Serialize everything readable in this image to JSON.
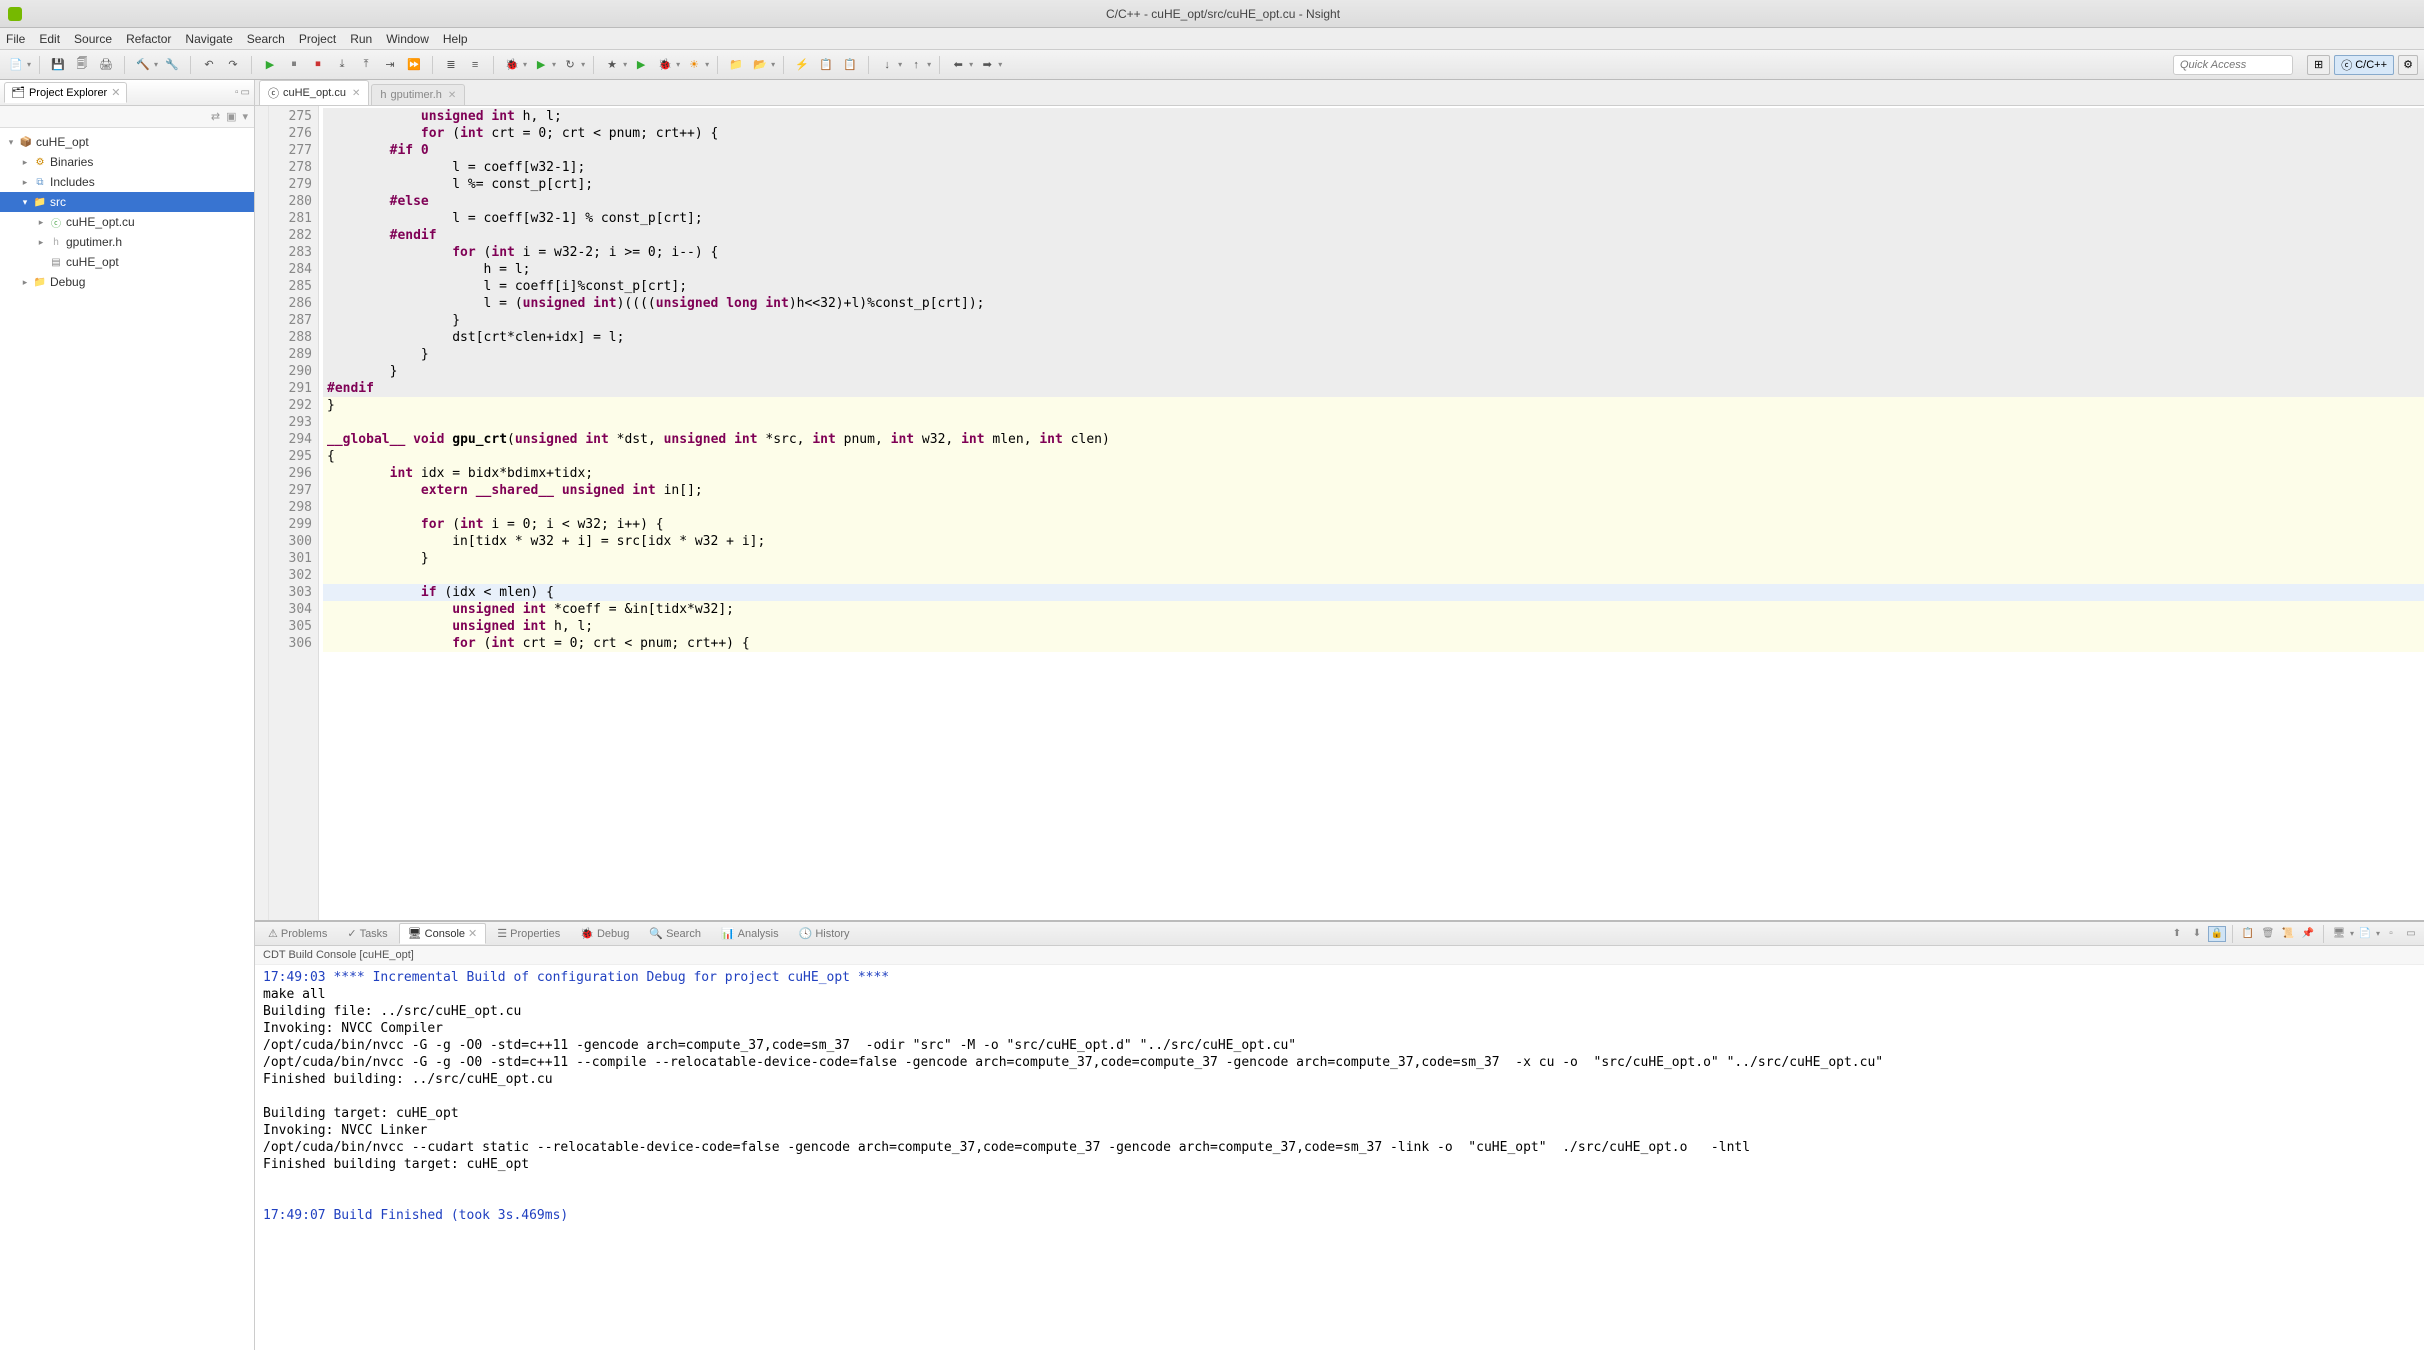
{
  "window": {
    "title": "C/C++ - cuHE_opt/src/cuHE_opt.cu - Nsight"
  },
  "menubar": [
    "File",
    "Edit",
    "Source",
    "Refactor",
    "Navigate",
    "Search",
    "Project",
    "Run",
    "Window",
    "Help"
  ],
  "quick_access_placeholder": "Quick Access",
  "perspective": {
    "active": "C/C++"
  },
  "sidebar": {
    "view_title": "Project Explorer",
    "tree": {
      "project": "cuHE_opt",
      "binaries": "Binaries",
      "includes": "Includes",
      "src": "src",
      "src_children": [
        {
          "name": "cuHE_opt.cu"
        },
        {
          "name": "gputimer.h"
        },
        {
          "name": "cuHE_opt"
        }
      ],
      "debug": "Debug"
    }
  },
  "editor": {
    "tabs": [
      {
        "label": "cuHE_opt.cu",
        "active": true
      },
      {
        "label": "gputimer.h",
        "active": false
      }
    ],
    "first_line": 275,
    "lines": [
      {
        "n": 275,
        "bg": "gray",
        "html": "            <span class='kw'>unsigned</span> <span class='kw'>int</span> h, l;"
      },
      {
        "n": 276,
        "bg": "gray",
        "html": "            <span class='kw'>for</span> (<span class='kw'>int</span> crt = 0; crt &lt; pnum; crt++) {"
      },
      {
        "n": 277,
        "bg": "gray",
        "html": "        <span class='pp'>#if 0</span>"
      },
      {
        "n": 278,
        "bg": "gray",
        "html": "                l = coeff[w32-1];"
      },
      {
        "n": 279,
        "bg": "gray",
        "html": "                l %= const_p[crt];"
      },
      {
        "n": 280,
        "bg": "gray",
        "html": "        <span class='pp'>#else</span>"
      },
      {
        "n": 281,
        "bg": "gray",
        "html": "                l = coeff[w32-1] % const_p[crt];"
      },
      {
        "n": 282,
        "bg": "gray",
        "html": "        <span class='pp'>#endif</span>"
      },
      {
        "n": 283,
        "bg": "gray",
        "html": "                <span class='kw'>for</span> (<span class='kw'>int</span> i = w32-2; i &gt;= 0; i--) {"
      },
      {
        "n": 284,
        "bg": "gray",
        "html": "                    h = l;"
      },
      {
        "n": 285,
        "bg": "gray",
        "html": "                    l = coeff[i]%const_p[crt];"
      },
      {
        "n": 286,
        "bg": "gray",
        "html": "                    l = (<span class='kw'>unsigned</span> <span class='kw'>int</span>)((((<span class='kw'>unsigned</span> <span class='kw'>long</span> <span class='kw'>int</span>)h&lt;&lt;32)+l)%const_p[crt]);"
      },
      {
        "n": 287,
        "bg": "gray",
        "html": "                }"
      },
      {
        "n": 288,
        "bg": "gray",
        "html": "                dst[crt*clen+idx] = l;"
      },
      {
        "n": 289,
        "bg": "gray",
        "html": "            }"
      },
      {
        "n": 290,
        "bg": "gray",
        "html": "        }"
      },
      {
        "n": 291,
        "bg": "gray",
        "html": "<span class='pp'>#endif</span>"
      },
      {
        "n": 292,
        "bg": "yel",
        "html": "}"
      },
      {
        "n": 293,
        "bg": "yel",
        "html": " "
      },
      {
        "n": 294,
        "bg": "yel",
        "html": "<span class='kw'>__global__</span> <span class='kw'>void</span> <span class='fn'>gpu_crt</span>(<span class='kw'>unsigned</span> <span class='kw'>int</span> *dst, <span class='kw'>unsigned</span> <span class='kw'>int</span> *src, <span class='kw'>int</span> pnum, <span class='kw'>int</span> w32, <span class='kw'>int</span> mlen, <span class='kw'>int</span> clen)"
      },
      {
        "n": 295,
        "bg": "yel",
        "html": "{"
      },
      {
        "n": 296,
        "bg": "yel",
        "html": "        <span class='kw'>int</span> idx = bidx*bdimx+tidx;"
      },
      {
        "n": 297,
        "bg": "yel",
        "html": "            <span class='kw'>extern</span> <span class='kw'>__shared__</span> <span class='kw'>unsigned</span> <span class='kw'>int</span> in[];"
      },
      {
        "n": 298,
        "bg": "yel",
        "html": " "
      },
      {
        "n": 299,
        "bg": "yel",
        "html": "            <span class='kw'>for</span> (<span class='kw'>int</span> i = 0; i &lt; w32; i++) {"
      },
      {
        "n": 300,
        "bg": "yel",
        "html": "                in[tidx * w32 + i] = src[idx * w32 + i];"
      },
      {
        "n": 301,
        "bg": "yel",
        "html": "            }"
      },
      {
        "n": 302,
        "bg": "yel",
        "html": " "
      },
      {
        "n": 303,
        "bg": "cur",
        "html": "            <span class='kw'>if</span> (idx &lt; mlen) {"
      },
      {
        "n": 304,
        "bg": "yel",
        "html": "                <span class='kw'>unsigned</span> <span class='kw'>int</span> *coeff = &amp;in[tidx*w32];"
      },
      {
        "n": 305,
        "bg": "yel",
        "html": "                <span class='kw'>unsigned</span> <span class='kw'>int</span> h, l;"
      },
      {
        "n": 306,
        "bg": "yel",
        "html": "                <span class='kw'>for</span> (<span class='kw'>int</span> crt = 0; crt &lt; pnum; crt++) {"
      }
    ]
  },
  "bottom": {
    "tabs": [
      "Problems",
      "Tasks",
      "Console",
      "Properties",
      "Debug",
      "Search",
      "Analysis",
      "History"
    ],
    "active_tab_index": 2,
    "console_header": "CDT Build Console [cuHE_opt]",
    "console_lines": [
      {
        "cls": "blue",
        "text": "17:49:03 **** Incremental Build of configuration Debug for project cuHE_opt ****"
      },
      {
        "cls": "",
        "text": "make all "
      },
      {
        "cls": "",
        "text": "Building file: ../src/cuHE_opt.cu"
      },
      {
        "cls": "",
        "text": "Invoking: NVCC Compiler"
      },
      {
        "cls": "",
        "text": "/opt/cuda/bin/nvcc -G -g -O0 -std=c++11 -gencode arch=compute_37,code=sm_37  -odir \"src\" -M -o \"src/cuHE_opt.d\" \"../src/cuHE_opt.cu\""
      },
      {
        "cls": "",
        "text": "/opt/cuda/bin/nvcc -G -g -O0 -std=c++11 --compile --relocatable-device-code=false -gencode arch=compute_37,code=compute_37 -gencode arch=compute_37,code=sm_37  -x cu -o  \"src/cuHE_opt.o\" \"../src/cuHE_opt.cu\""
      },
      {
        "cls": "",
        "text": "Finished building: ../src/cuHE_opt.cu"
      },
      {
        "cls": "",
        "text": " "
      },
      {
        "cls": "",
        "text": "Building target: cuHE_opt"
      },
      {
        "cls": "",
        "text": "Invoking: NVCC Linker"
      },
      {
        "cls": "",
        "text": "/opt/cuda/bin/nvcc --cudart static --relocatable-device-code=false -gencode arch=compute_37,code=compute_37 -gencode arch=compute_37,code=sm_37 -link -o  \"cuHE_opt\"  ./src/cuHE_opt.o   -lntl"
      },
      {
        "cls": "",
        "text": "Finished building target: cuHE_opt"
      },
      {
        "cls": "",
        "text": " "
      },
      {
        "cls": "",
        "text": " "
      },
      {
        "cls": "blue",
        "text": "17:49:07 Build Finished (took 3s.469ms)"
      }
    ]
  },
  "toolbar_icons": [
    {
      "g": "📄",
      "n": "new-icon",
      "d": true
    },
    {
      "g": "|"
    },
    {
      "g": "💾",
      "n": "save-icon"
    },
    {
      "g": "🗐",
      "n": "save-all-icon"
    },
    {
      "g": "🖨",
      "n": "print-icon"
    },
    {
      "g": "|"
    },
    {
      "g": "🔨",
      "n": "build-icon",
      "d": true
    },
    {
      "g": "🔧",
      "n": "build-config-icon"
    },
    {
      "g": "|"
    },
    {
      "g": "↶",
      "n": "undo-icon"
    },
    {
      "g": "↷",
      "n": "redo-icon"
    },
    {
      "g": "|"
    },
    {
      "g": "▶",
      "n": "resume-icon",
      "c": "#3a3"
    },
    {
      "g": "⏸",
      "n": "suspend-icon"
    },
    {
      "g": "⏹",
      "n": "terminate-icon",
      "c": "#c33"
    },
    {
      "g": "⤓",
      "n": "step-into-icon"
    },
    {
      "g": "⤒",
      "n": "step-over-icon"
    },
    {
      "g": "⇥",
      "n": "step-return-icon"
    },
    {
      "g": "⏩",
      "n": "run-to-line-icon"
    },
    {
      "g": "|"
    },
    {
      "g": "≣",
      "n": "instruction-step-icon"
    },
    {
      "g": "≡",
      "n": "toggle-icon"
    },
    {
      "g": "|"
    },
    {
      "g": "🐞",
      "n": "debug-icon",
      "c": "#4a4",
      "d": true
    },
    {
      "g": "▶",
      "n": "run-icon",
      "c": "#3a3",
      "d": true
    },
    {
      "g": "↻",
      "n": "profile-icon",
      "d": true
    },
    {
      "g": "|"
    },
    {
      "g": "★",
      "n": "favorites-icon",
      "d": true
    },
    {
      "g": "▶",
      "n": "run-last-icon",
      "c": "#3a3"
    },
    {
      "g": "🐞",
      "n": "debug-last-icon",
      "c": "#4a4",
      "d": true
    },
    {
      "g": "☀",
      "n": "coverage-icon",
      "c": "#e80",
      "d": true
    },
    {
      "g": "|"
    },
    {
      "g": "📁",
      "n": "open-type-icon"
    },
    {
      "g": "📂",
      "n": "open-element-icon",
      "d": true
    },
    {
      "g": "|"
    },
    {
      "g": "⚡",
      "n": "toggle-breadcrumb-icon"
    },
    {
      "g": "📋",
      "n": "task-icon"
    },
    {
      "g": "📋",
      "n": "task2-icon"
    },
    {
      "g": "|"
    },
    {
      "g": "↓",
      "n": "next-annotation-icon",
      "d": true
    },
    {
      "g": "↑",
      "n": "prev-annotation-icon",
      "d": true
    },
    {
      "g": "|"
    },
    {
      "g": "⬅",
      "n": "back-icon",
      "d": true
    },
    {
      "g": "➡",
      "n": "forward-icon",
      "d": true
    }
  ],
  "bottom_tools": [
    {
      "g": "⬆",
      "n": "scroll-up-icon"
    },
    {
      "g": "⬇",
      "n": "scroll-down-icon"
    },
    {
      "g": "🔒",
      "n": "scroll-lock-icon",
      "active": true
    },
    {
      "g": "|"
    },
    {
      "g": "📋",
      "n": "copy-icon"
    },
    {
      "g": "🗑",
      "n": "clear-icon"
    },
    {
      "g": "📜",
      "n": "wrap-icon"
    },
    {
      "g": "📌",
      "n": "pin-icon"
    },
    {
      "g": "|"
    },
    {
      "g": "🖥",
      "n": "display-console-icon",
      "d": true
    },
    {
      "g": "📄",
      "n": "open-console-icon",
      "d": true
    },
    {
      "g": "▫",
      "n": "min-icon"
    },
    {
      "g": "▭",
      "n": "max-icon"
    }
  ]
}
